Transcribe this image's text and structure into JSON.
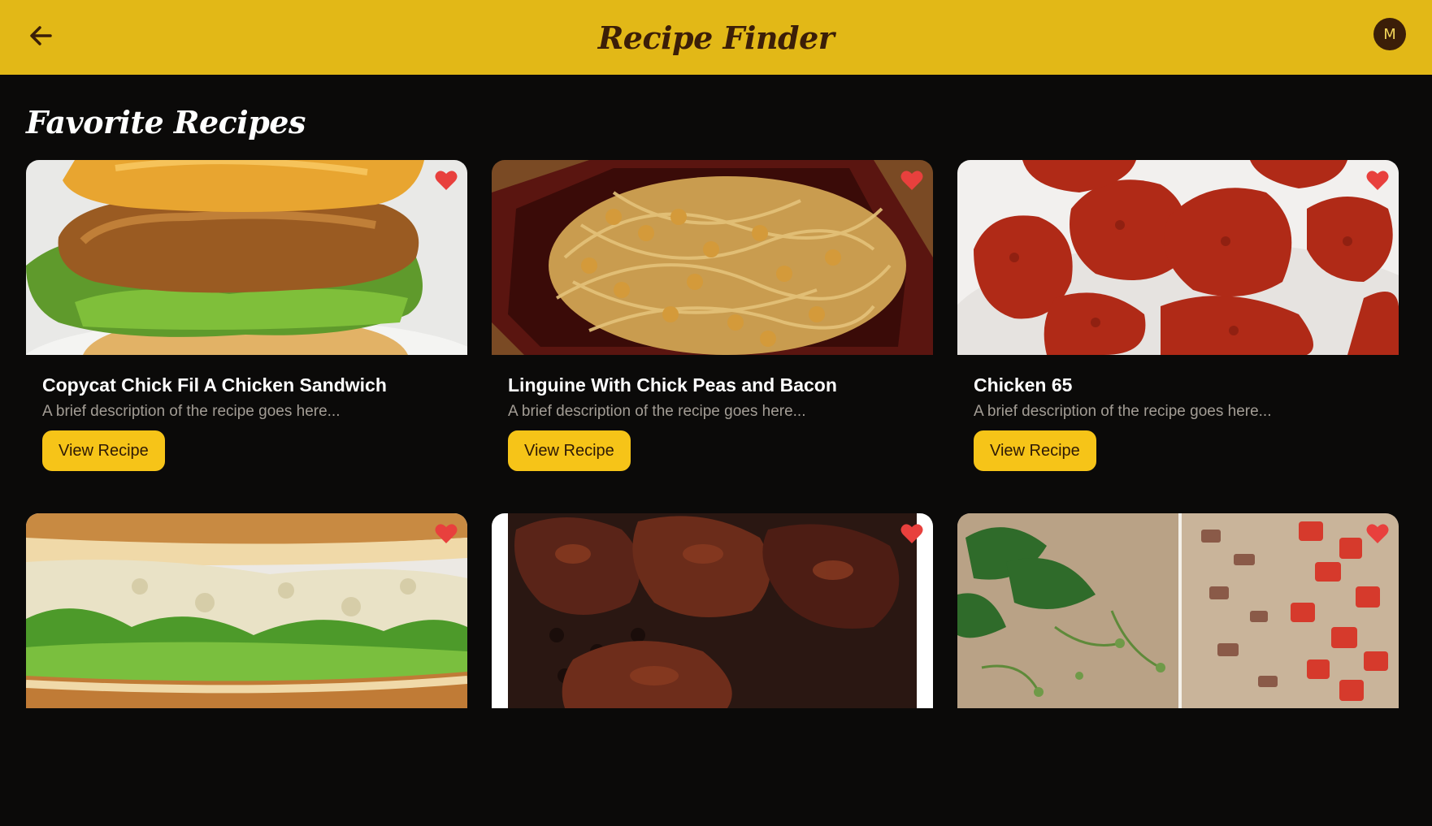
{
  "header": {
    "back_icon": "arrow-left-icon",
    "title": "Recipe Finder",
    "avatar_initial": "M",
    "background_color": "#e2b817",
    "title_color": "#3b1e08"
  },
  "section": {
    "title": "Favorite Recipes"
  },
  "recipes": [
    {
      "title": "Copycat Chick Fil A Chicken Sandwich",
      "description": "A brief description of the recipe goes here...",
      "button_label": "View Recipe",
      "favorite": true,
      "image": "chicken-sandwich-photo"
    },
    {
      "title": "Linguine With Chick Peas and Bacon",
      "description": "A brief description of the recipe goes here...",
      "button_label": "View Recipe",
      "favorite": true,
      "image": "linguine-chickpeas-photo"
    },
    {
      "title": "Chicken 65",
      "description": "A brief description of the recipe goes here...",
      "button_label": "View Recipe",
      "favorite": true,
      "image": "fried-chicken-pieces-photo"
    },
    {
      "title": "",
      "description": "",
      "button_label": "",
      "favorite": true,
      "image": "chicken-salad-sandwich-photo"
    },
    {
      "title": "",
      "description": "",
      "button_label": "",
      "favorite": true,
      "image": "grilled-chicken-photo"
    },
    {
      "title": "",
      "description": "",
      "button_label": "",
      "favorite": true,
      "image": "herbs-and-tomatoes-photo"
    }
  ],
  "colors": {
    "page_background": "#0b0a09",
    "button": "#f6c418",
    "heart": "#e8403d",
    "description_text": "#a39d95"
  }
}
